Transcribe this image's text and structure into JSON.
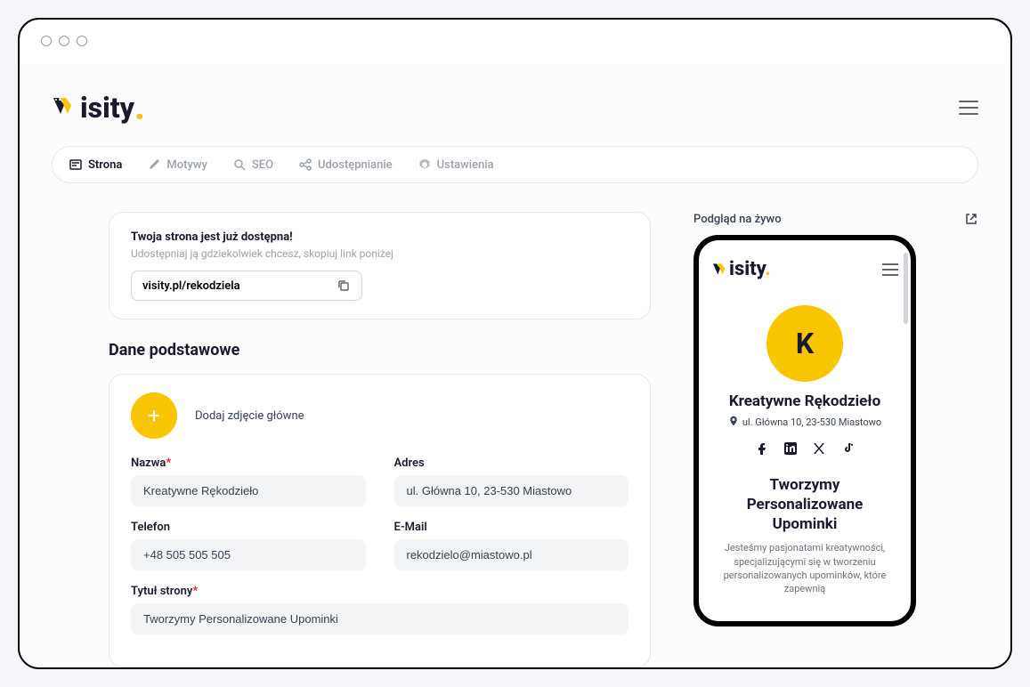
{
  "brand": {
    "name": "isity",
    "dot": "."
  },
  "tabs": [
    {
      "label": "Strona",
      "icon": "page-icon"
    },
    {
      "label": "Motywy",
      "icon": "brush-icon"
    },
    {
      "label": "SEO",
      "icon": "search-icon"
    },
    {
      "label": "Udostępnianie",
      "icon": "share-icon"
    },
    {
      "label": "Ustawienia",
      "icon": "gear-icon"
    }
  ],
  "share_card": {
    "title": "Twoja strona jest już dostępna!",
    "subtitle": "Udostępniaj ją gdziekolwiek chcesz, skopiuj link poniżej",
    "url": "visity.pl/rekodziela"
  },
  "section_title": "Dane podstawowe",
  "photo_label": "Dodaj zdjęcie główne",
  "fields": {
    "nazwa": {
      "label": "Nazwa",
      "required": true,
      "value": "Kreatywne Rękodzieło"
    },
    "adres": {
      "label": "Adres",
      "required": false,
      "value": "ul. Główna 10, 23-530 Miastowo"
    },
    "telefon": {
      "label": "Telefon",
      "required": false,
      "value": "+48 505 505 505"
    },
    "email": {
      "label": "E-Mail",
      "required": false,
      "value": "rekodzielo@miastowo.pl"
    },
    "tytul": {
      "label": "Tytuł strony",
      "required": true,
      "value": "Tworzymy Personalizowane Upominki"
    }
  },
  "preview": {
    "header": "Podgląd na żywo",
    "avatar_letter": "K",
    "business_name": "Kreatywne Rękodzieło",
    "address": "ul. Główna 10, 23-530 Miastowo",
    "slogan": "Tworzymy Personalizowane Upominki",
    "description": "Jesteśmy pasjonatami kreatywności, specjalizującymi się w tworzeniu personalizowanych upominków, które zapewnią"
  }
}
